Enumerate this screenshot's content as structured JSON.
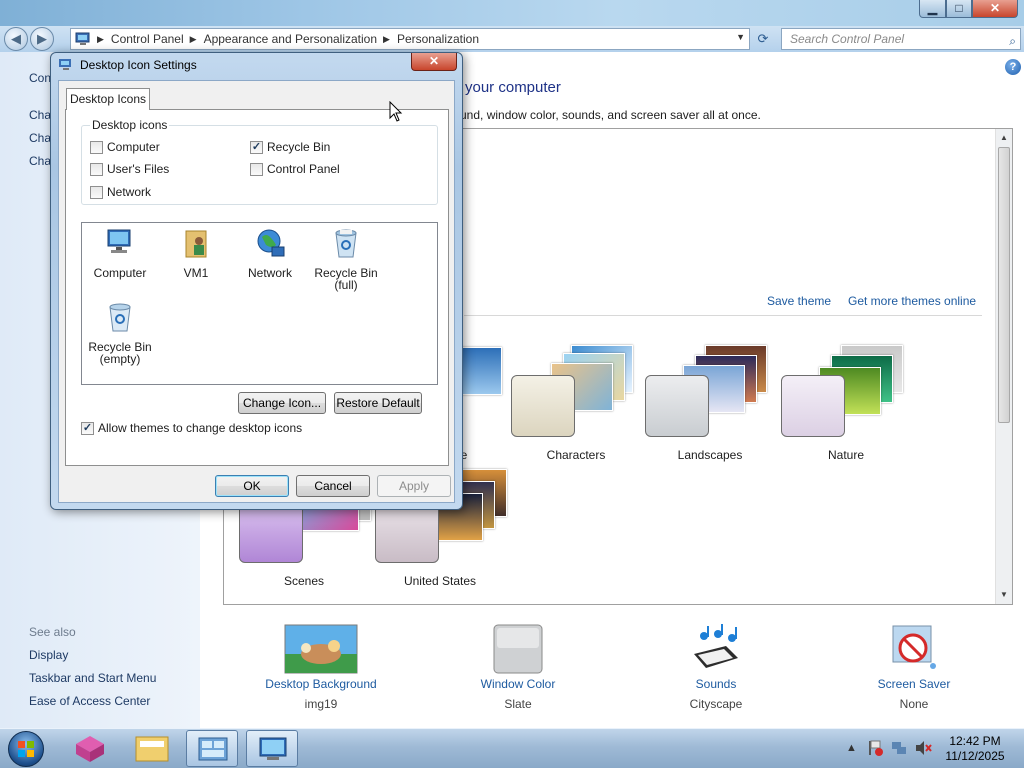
{
  "window": {
    "minimize_glyph": "▁",
    "maximize_glyph": "□",
    "close_glyph": "✕"
  },
  "address": {
    "crumbs": [
      "Control Panel",
      "Appearance and Personalization",
      "Personalization"
    ],
    "search_placeholder": "Search Control Panel"
  },
  "left_pane": {
    "partial_items": [
      "Con",
      "Cha",
      "Cha",
      "Cha"
    ],
    "see_also_label": "See also",
    "see_also_links": [
      "Display",
      "Taskbar and Start Menu",
      "Ease of Access Center"
    ]
  },
  "content": {
    "heading": "your computer",
    "subheading": "und, window color, sounds, and screen saver all at once.",
    "save_theme": "Save theme",
    "get_more_themes": "Get more themes online",
    "themes": [
      {
        "label": "e",
        "color": "#6b9ed6"
      },
      {
        "label": "Characters",
        "color": "#e6e1cf"
      },
      {
        "label": "Landscapes",
        "color": "#d9dde1"
      },
      {
        "label": "Nature",
        "color": "#e8e1ec"
      },
      {
        "label": "Scenes",
        "color": "#c9a6e6"
      },
      {
        "label": "United States",
        "color": "#d8cfd6"
      }
    ],
    "bottom_items": [
      {
        "label": "Desktop Background",
        "sub": "img19"
      },
      {
        "label": "Window Color",
        "sub": "Slate"
      },
      {
        "label": "Sounds",
        "sub": "Cityscape"
      },
      {
        "label": "Screen Saver",
        "sub": "None"
      }
    ]
  },
  "dialog": {
    "title": "Desktop Icon Settings",
    "tab": "Desktop Icons",
    "group_label": "Desktop icons",
    "checkboxes": [
      {
        "label": "Computer",
        "checked": false
      },
      {
        "label": "Recycle Bin",
        "checked": true
      },
      {
        "label": "User's Files",
        "checked": false
      },
      {
        "label": "Control Panel",
        "checked": false
      },
      {
        "label": "Network",
        "checked": false
      }
    ],
    "icons": [
      {
        "label": "Computer",
        "label2": "",
        "icon": "computer-icon"
      },
      {
        "label": "VM1",
        "label2": "",
        "icon": "user-folder-icon"
      },
      {
        "label": "Network",
        "label2": "",
        "icon": "network-globe-icon"
      },
      {
        "label": "Recycle Bin",
        "label2": "(full)",
        "icon": "recycle-bin-full-icon"
      },
      {
        "label": "Recycle Bin",
        "label2": "(empty)",
        "icon": "recycle-bin-empty-icon"
      }
    ],
    "change_icon": "Change Icon...",
    "restore_default": "Restore Default",
    "allow_themes": "Allow themes to change desktop icons",
    "allow_themes_checked": true,
    "ok": "OK",
    "cancel": "Cancel",
    "apply": "Apply"
  },
  "taskbar": {
    "time": "12:42 PM",
    "date": "11/12/2025"
  }
}
